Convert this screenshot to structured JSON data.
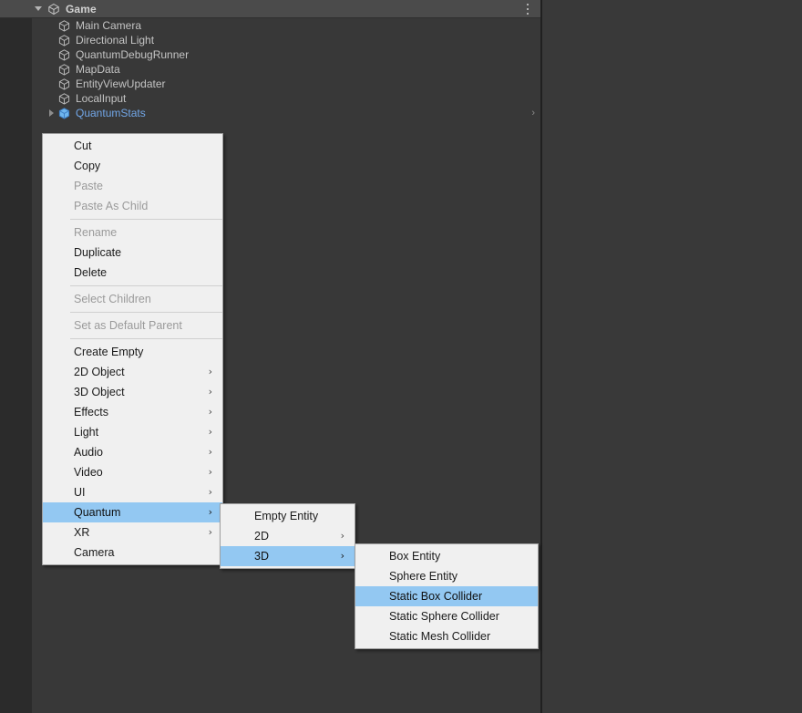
{
  "window": {
    "title": "Game",
    "scene_icon": "unity-scene-icon",
    "options_icon": "kebab-menu-icon",
    "foldout_state": "expanded"
  },
  "hierarchy": {
    "items": [
      {
        "label": "Main Camera",
        "icon": "gameobject-cube-icon",
        "type": "gameobject",
        "expandable": false
      },
      {
        "label": "Directional Light",
        "icon": "gameobject-cube-icon",
        "type": "gameobject",
        "expandable": false
      },
      {
        "label": "QuantumDebugRunner",
        "icon": "gameobject-cube-icon",
        "type": "gameobject",
        "expandable": false
      },
      {
        "label": "MapData",
        "icon": "gameobject-cube-icon",
        "type": "gameobject",
        "expandable": false
      },
      {
        "label": "EntityViewUpdater",
        "icon": "gameobject-cube-icon",
        "type": "gameobject",
        "expandable": false
      },
      {
        "label": "LocalInput",
        "icon": "gameobject-cube-icon",
        "type": "gameobject",
        "expandable": false
      },
      {
        "label": "QuantumStats",
        "icon": "prefab-cube-icon",
        "type": "prefab",
        "expandable": true,
        "chevron": "›"
      }
    ]
  },
  "context_menu": {
    "items": [
      {
        "label": "Cut",
        "disabled": false,
        "submenu": false
      },
      {
        "label": "Copy",
        "disabled": false,
        "submenu": false
      },
      {
        "label": "Paste",
        "disabled": true,
        "submenu": false
      },
      {
        "label": "Paste As Child",
        "disabled": true,
        "submenu": false
      },
      {
        "separator": true
      },
      {
        "label": "Rename",
        "disabled": true,
        "submenu": false
      },
      {
        "label": "Duplicate",
        "disabled": false,
        "submenu": false
      },
      {
        "label": "Delete",
        "disabled": false,
        "submenu": false
      },
      {
        "separator": true
      },
      {
        "label": "Select Children",
        "disabled": true,
        "submenu": false
      },
      {
        "separator": true
      },
      {
        "label": "Set as Default Parent",
        "disabled": true,
        "submenu": false
      },
      {
        "separator": true
      },
      {
        "label": "Create Empty",
        "disabled": false,
        "submenu": false
      },
      {
        "label": "2D Object",
        "disabled": false,
        "submenu": true,
        "arrow": "›"
      },
      {
        "label": "3D Object",
        "disabled": false,
        "submenu": true,
        "arrow": "›"
      },
      {
        "label": "Effects",
        "disabled": false,
        "submenu": true,
        "arrow": "›"
      },
      {
        "label": "Light",
        "disabled": false,
        "submenu": true,
        "arrow": "›"
      },
      {
        "label": "Audio",
        "disabled": false,
        "submenu": true,
        "arrow": "›"
      },
      {
        "label": "Video",
        "disabled": false,
        "submenu": true,
        "arrow": "›"
      },
      {
        "label": "UI",
        "disabled": false,
        "submenu": true,
        "arrow": "›"
      },
      {
        "label": "Quantum",
        "disabled": false,
        "submenu": true,
        "arrow": "›",
        "selected": true
      },
      {
        "label": "XR",
        "disabled": false,
        "submenu": true,
        "arrow": "›"
      },
      {
        "label": "Camera",
        "disabled": false,
        "submenu": false
      }
    ]
  },
  "submenu_quantum": {
    "parent": "Quantum",
    "items": [
      {
        "label": "Empty Entity",
        "disabled": false,
        "submenu": false
      },
      {
        "label": "2D",
        "disabled": false,
        "submenu": true,
        "arrow": "›"
      },
      {
        "label": "3D",
        "disabled": false,
        "submenu": true,
        "arrow": "›",
        "selected": true
      }
    ]
  },
  "submenu_3d": {
    "parent": "3D",
    "items": [
      {
        "label": "Box Entity",
        "disabled": false,
        "submenu": false
      },
      {
        "label": "Sphere Entity",
        "disabled": false,
        "submenu": false
      },
      {
        "label": "Static Box Collider",
        "disabled": false,
        "submenu": false,
        "selected": true
      },
      {
        "label": "Static Sphere Collider",
        "disabled": false,
        "submenu": false
      },
      {
        "label": "Static Mesh Collider",
        "disabled": false,
        "submenu": false
      }
    ]
  },
  "colors": {
    "panel_background": "#383838",
    "gutter_background": "#2b2b2b",
    "header_background": "#4b4b4b",
    "menu_background": "#f0f0f0",
    "menu_highlight": "#93c8f2",
    "prefab_text": "#72a7e8",
    "label_text": "#c4c4c4",
    "disabled_text": "#9a9a9a"
  }
}
